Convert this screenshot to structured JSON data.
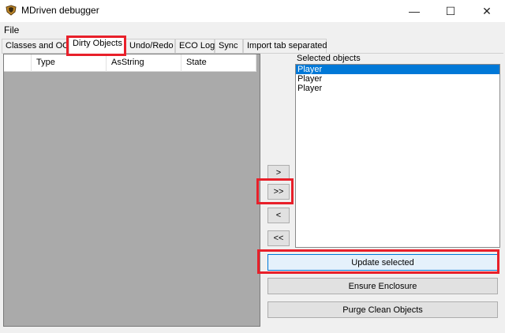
{
  "window": {
    "title": "MDriven debugger",
    "min_glyph": "—",
    "max_glyph": "☐",
    "close_glyph": "✕"
  },
  "menu": {
    "file": "File"
  },
  "tabs": [
    "Classes and OCL",
    "Dirty Objects",
    "Undo/Redo",
    "ECO Log",
    "Sync",
    "Import tab separated"
  ],
  "active_tab": "Dirty Objects",
  "grid": {
    "columns": [
      "Type",
      "AsString",
      "State"
    ]
  },
  "buttons": {
    "move_one": ">",
    "move_all": ">>",
    "remove_one": "<",
    "remove_all": "<<",
    "update": "Update selected",
    "ensure": "Ensure Enclosure",
    "purge": "Purge Clean Objects"
  },
  "selected_objects": {
    "label": "Selected objects",
    "items": [
      "Player",
      "Player",
      "Player"
    ],
    "selected_index": 0
  },
  "colors": {
    "highlight": "#e8202a",
    "selection": "#0078d7",
    "grid_bg": "#aaaaaa"
  }
}
